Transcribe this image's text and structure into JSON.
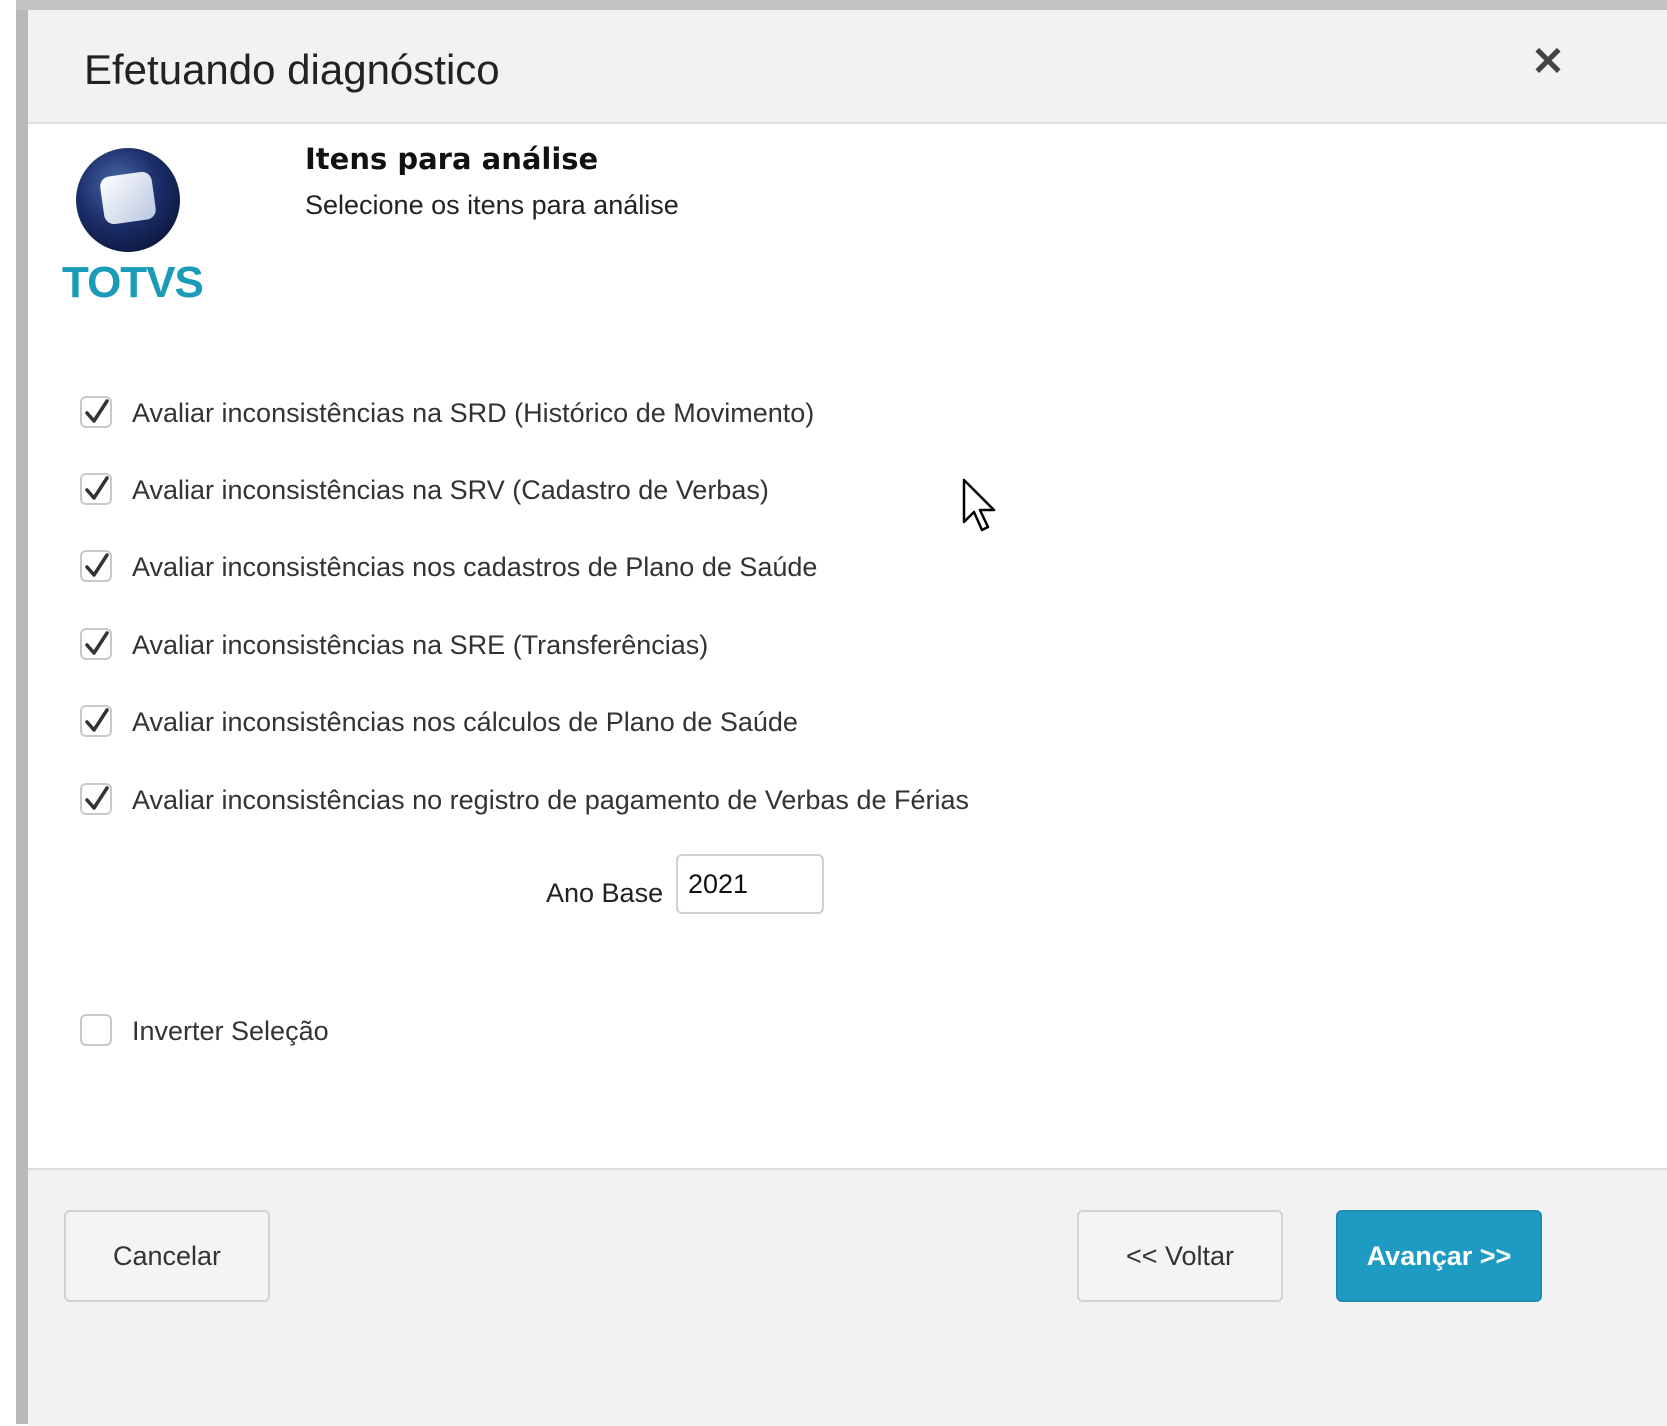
{
  "dialog": {
    "title": "Efetuando diagnóstico",
    "close_icon": "close-icon"
  },
  "logo": {
    "text": "TOTVS",
    "icon": "totvs-logo",
    "color": "#1a9bb8"
  },
  "step": {
    "title": "Itens para análise",
    "subtitle": "Selecione os itens para análise"
  },
  "options": [
    {
      "label": "Avaliar inconsistências na SRD (Histórico de Movimento)",
      "checked": true
    },
    {
      "label": "Avaliar inconsistências na SRV (Cadastro de Verbas)",
      "checked": true
    },
    {
      "label": "Avaliar inconsistências nos cadastros de Plano de Saúde",
      "checked": true
    },
    {
      "label": "Avaliar inconsistências na SRE (Transferências)",
      "checked": true
    },
    {
      "label": "Avaliar inconsistências nos cálculos de Plano de Saúde",
      "checked": true
    },
    {
      "label": "Avaliar inconsistências no registro de pagamento de Verbas de Férias",
      "checked": true
    }
  ],
  "year": {
    "label": "Ano Base",
    "value": "2021"
  },
  "invert": {
    "label": "Inverter Seleção",
    "checked": false
  },
  "footer": {
    "cancel_label": "Cancelar",
    "back_label": "<< Voltar",
    "next_label": "Avançar >>",
    "primary_color": "#1e9bc2"
  }
}
